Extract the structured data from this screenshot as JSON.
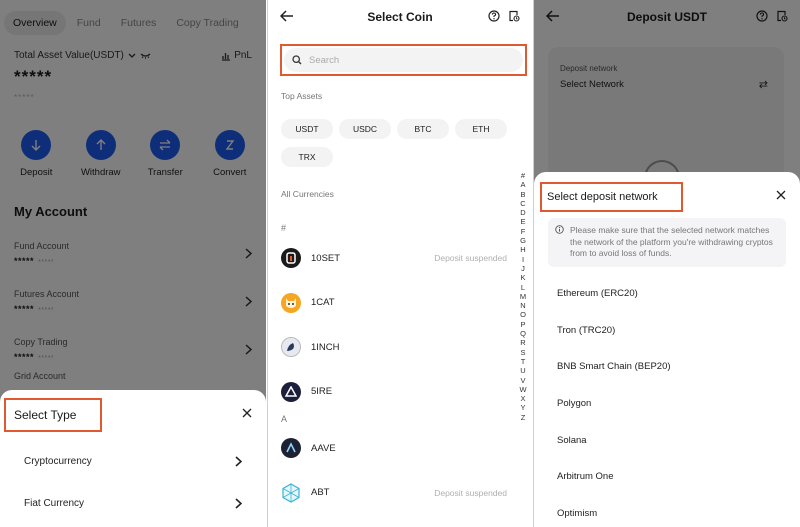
{
  "panel1": {
    "tabs": [
      "Overview",
      "Fund",
      "Futures",
      "Copy Trading"
    ],
    "total_asset_label": "Total Asset Value(USDT)",
    "pnl_label": "PnL",
    "masked_total": "*****",
    "masked_sub": "*****",
    "actions": [
      {
        "label": "Deposit",
        "icon": "arrow-down-icon"
      },
      {
        "label": "Withdraw",
        "icon": "arrow-up-icon"
      },
      {
        "label": "Transfer",
        "icon": "transfer-icon"
      },
      {
        "label": "Convert",
        "icon": "convert-icon"
      }
    ],
    "my_account_title": "My Account",
    "accounts": [
      {
        "title": "Fund Account",
        "mask": "*****",
        "mask_sub": "*****"
      },
      {
        "title": "Futures Account",
        "mask": "*****",
        "mask_sub": "*****"
      },
      {
        "title": "Copy Trading",
        "mask": "*****",
        "mask_sub": "*****"
      }
    ],
    "partial_account": "Grid Account",
    "sheet": {
      "title": "Select Type",
      "items": [
        "Cryptocurrency",
        "Fiat Currency"
      ]
    }
  },
  "panel2": {
    "title": "Select Coin",
    "search_placeholder": "Search",
    "top_assets_label": "Top Assets",
    "top_assets": [
      "USDT",
      "USDC",
      "BTC",
      "ETH",
      "TRX"
    ],
    "all_currencies_label": "All Currencies",
    "group_hash": "#",
    "group_a": "A",
    "coins": [
      {
        "name": "10SET",
        "status": "Deposit suspended"
      },
      {
        "name": "1CAT",
        "status": ""
      },
      {
        "name": "1INCH",
        "status": ""
      },
      {
        "name": "5IRE",
        "status": ""
      },
      {
        "name": "AAVE",
        "status": ""
      },
      {
        "name": "ABT",
        "status": "Deposit suspended"
      }
    ],
    "alphabet": [
      "#",
      "A",
      "B",
      "C",
      "D",
      "E",
      "F",
      "G",
      "H",
      "I",
      "J",
      "K",
      "L",
      "M",
      "N",
      "O",
      "P",
      "Q",
      "R",
      "S",
      "T",
      "U",
      "V",
      "W",
      "X",
      "Y",
      "Z"
    ]
  },
  "panel3": {
    "title": "Deposit USDT",
    "deposit_network_label": "Deposit network",
    "select_network_value": "Select Network",
    "sheet": {
      "title": "Select deposit network",
      "notice": "Please make sure that the selected network matches the network of the platform you're withdrawing cryptos from to avoid loss of funds.",
      "networks": [
        "Ethereum (ERC20)",
        "Tron (TRC20)",
        "BNB Smart Chain (BEP20)",
        "Polygon",
        "Solana",
        "Arbitrum One",
        "Optimism"
      ]
    }
  },
  "colors": {
    "accent": "#1f5cf2",
    "highlight": "#e2582f"
  }
}
